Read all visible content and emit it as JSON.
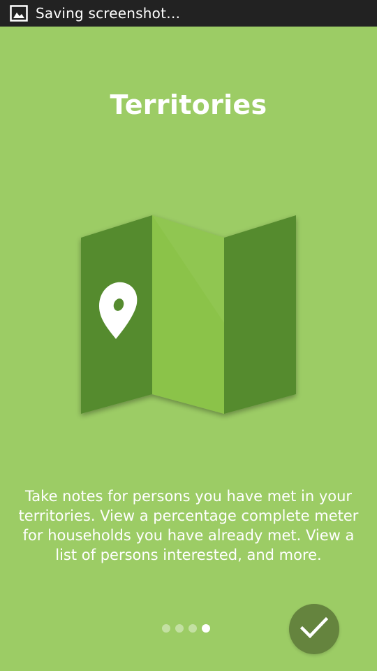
{
  "status_bar": {
    "icon": "image-icon",
    "text": "Saving screenshot…"
  },
  "slide": {
    "title": "Territories",
    "illustration_icon": "folded-map-with-location-pin-icon",
    "description": "Take notes for persons you have met in your territories. View a percentage complete meter for households you have already met. View a list of persons interested, and more."
  },
  "pager": {
    "total_pages": 4,
    "current_page": 4
  },
  "done_button": {
    "icon": "checkmark-icon"
  },
  "colors": {
    "background": "#9ccc65",
    "map_dark": "#558b2f",
    "map_light": "#8bc34a",
    "done_button": "#65843e",
    "status_bar": "#222222"
  }
}
